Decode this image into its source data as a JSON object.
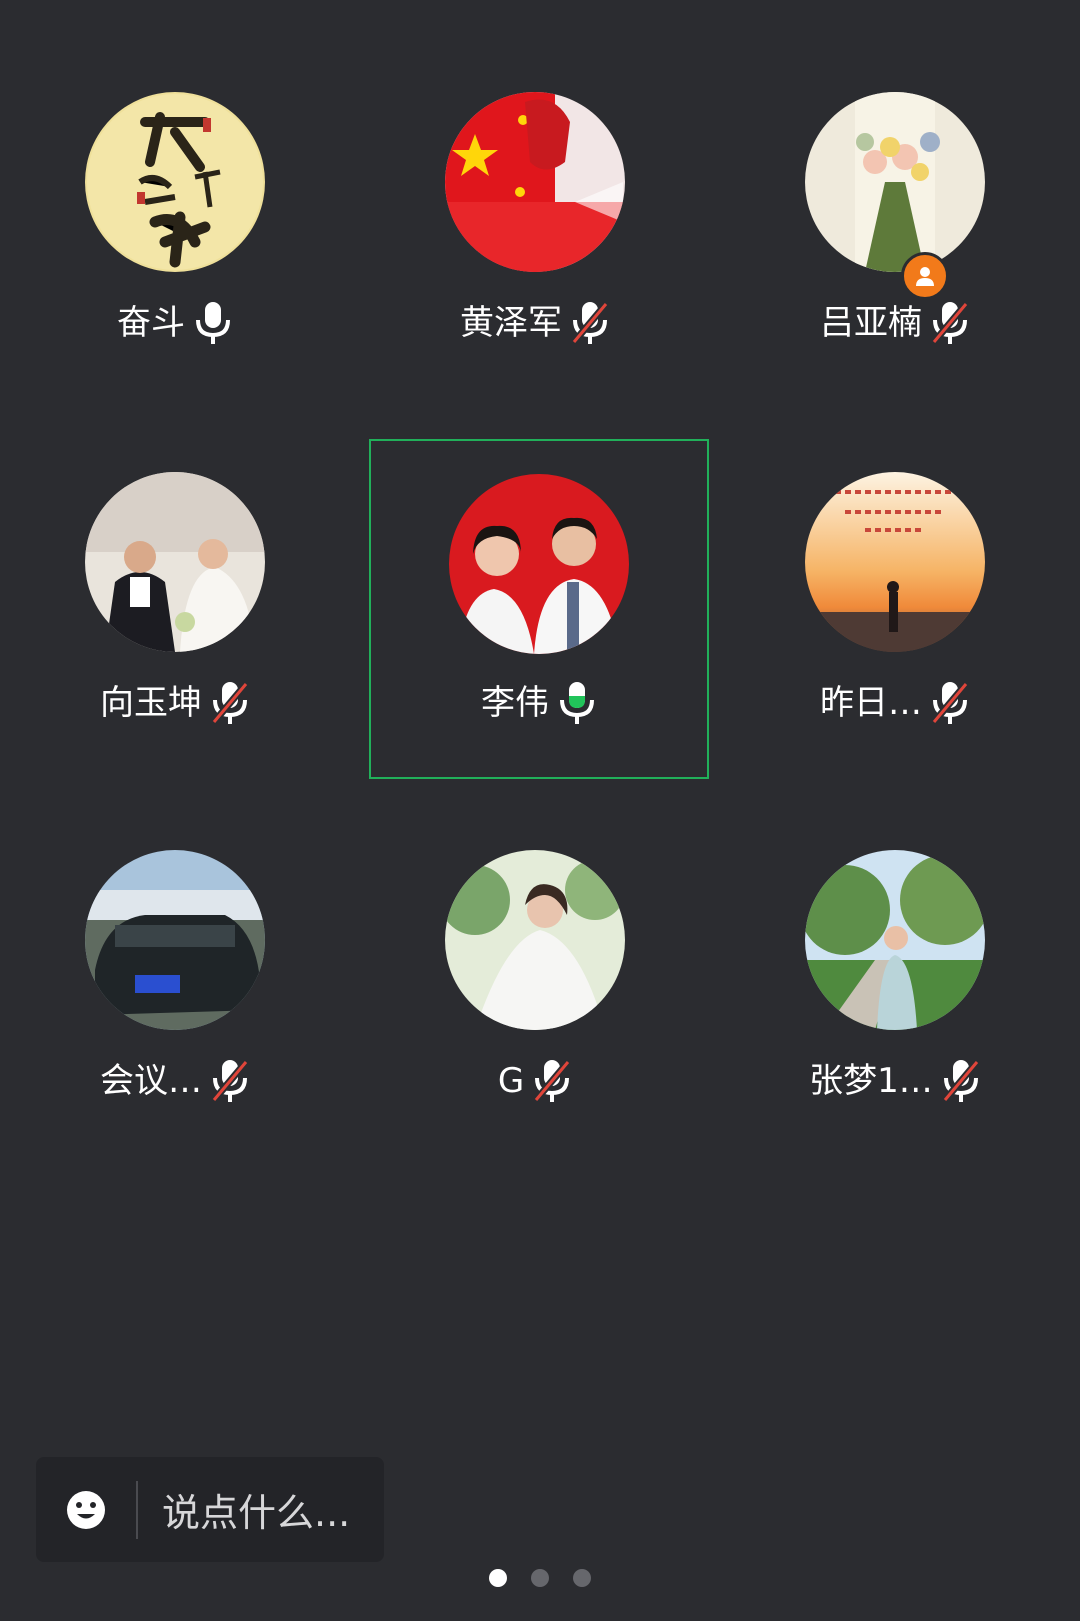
{
  "participants": [
    {
      "name": "奋斗",
      "mic": "on",
      "speaking": false,
      "avatar": "calligraphy-avatar",
      "badge": false
    },
    {
      "name": "黄泽军",
      "mic": "muted",
      "speaking": false,
      "avatar": "flag-portrait-avatar",
      "badge": false
    },
    {
      "name": "吕亚楠",
      "mic": "muted",
      "speaking": false,
      "avatar": "flower-bouquet-avatar",
      "badge": true
    },
    {
      "name": "向玉坤",
      "mic": "muted",
      "speaking": false,
      "avatar": "wedding-photo-avatar",
      "badge": false
    },
    {
      "name": "李伟",
      "mic": "on",
      "speaking": true,
      "avatar": "couple-photo-avatar",
      "badge": false
    },
    {
      "name": "昨日…",
      "mic": "muted",
      "speaking": false,
      "avatar": "sunset-silhouette-avatar",
      "badge": false
    },
    {
      "name": "会议…",
      "mic": "muted",
      "speaking": false,
      "avatar": "car-avatar",
      "badge": false
    },
    {
      "name": "G",
      "mic": "muted",
      "speaking": false,
      "avatar": "bride-veil-avatar",
      "badge": false
    },
    {
      "name": "张梦1…",
      "mic": "muted",
      "speaking": false,
      "avatar": "garden-portrait-avatar",
      "badge": false
    }
  ],
  "composer": {
    "placeholder": "说点什么..."
  },
  "pagination": {
    "pages": 3,
    "current": 1
  },
  "colors": {
    "background": "#2b2c30",
    "active_border": "#21b05a",
    "speaking_green": "#21c45a",
    "muted_red": "#e0453a",
    "badge_orange": "#f27a1a"
  }
}
